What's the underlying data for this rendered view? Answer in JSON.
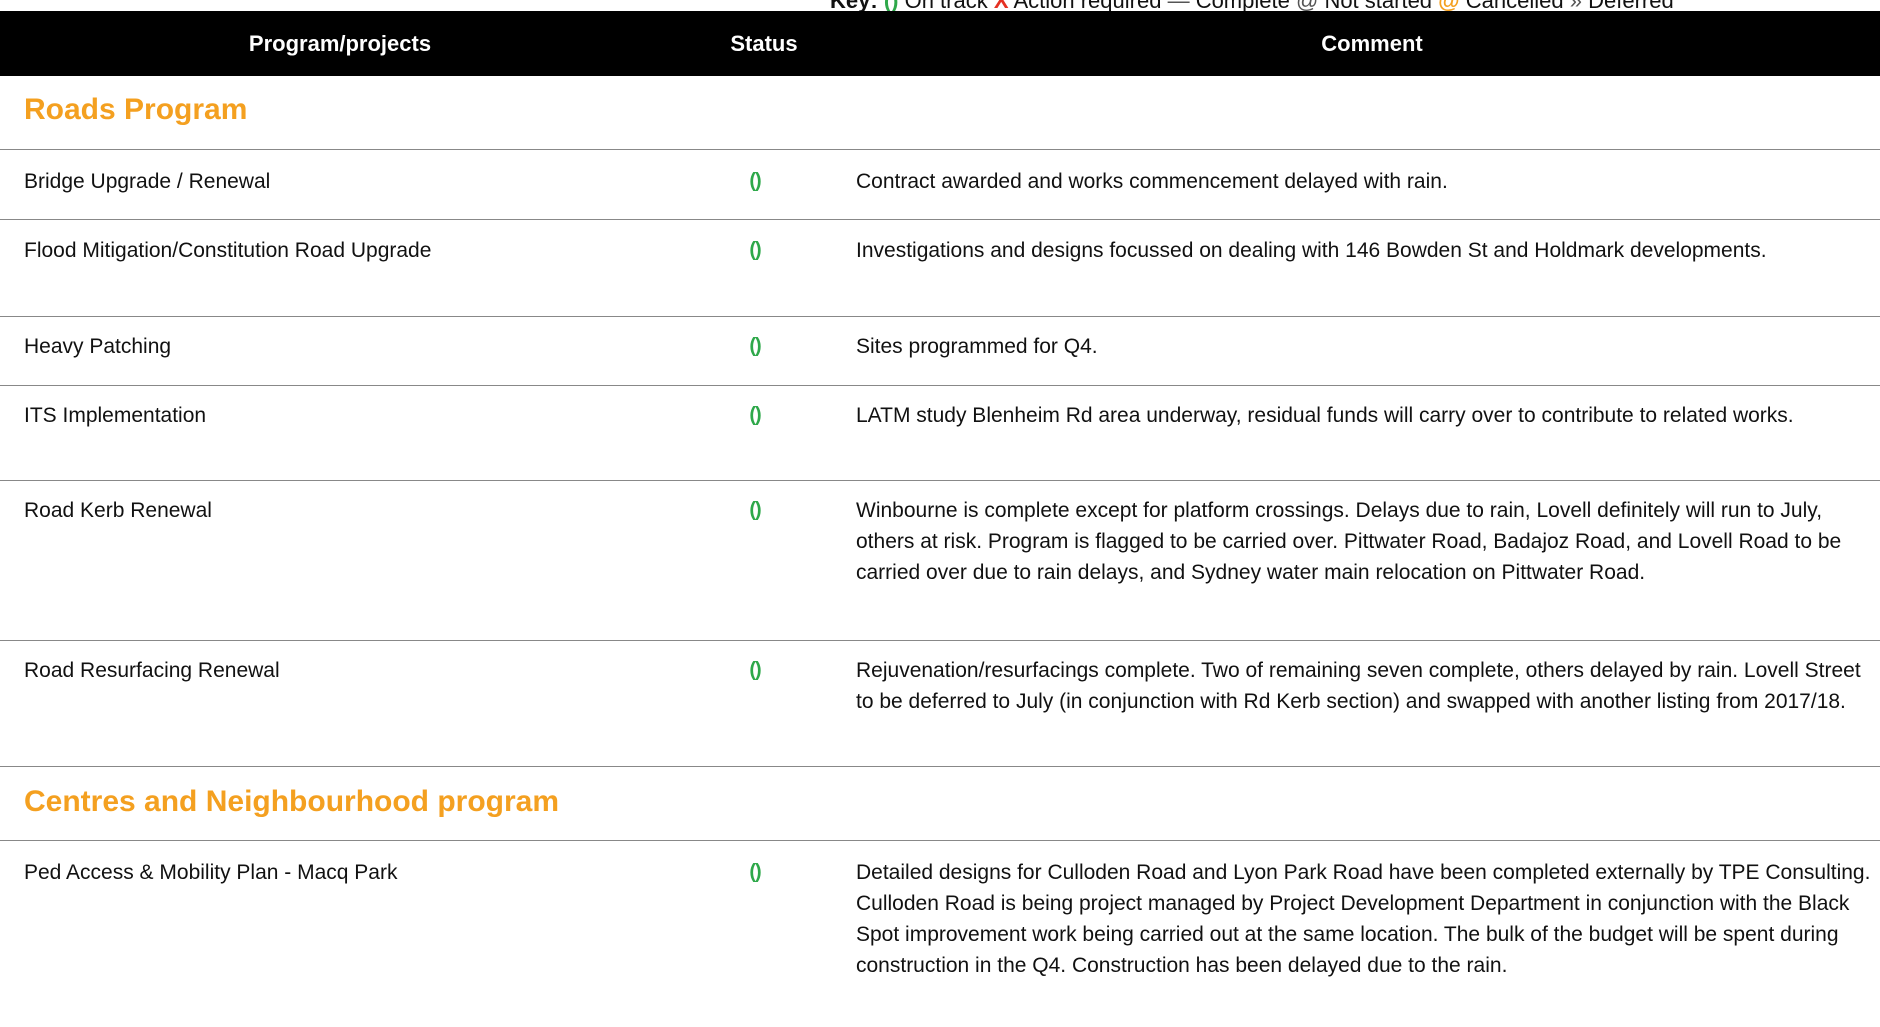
{
  "key": {
    "label": "Key:",
    "on_track_symbol": "()",
    "on_track": "On track",
    "action_symbol": "X",
    "action": "Action required",
    "complete_symbol": "—",
    "complete": "Complete",
    "not_started_symbol": "@",
    "not_started": "Not started",
    "cancelled_symbol": "@",
    "cancelled": "Cancelled",
    "deferred_symbol": "»",
    "deferred": "Deferred"
  },
  "header": {
    "program": "Program/projects",
    "status": "Status",
    "comment": "Comment"
  },
  "sections": [
    {
      "title": "Roads Program",
      "rows": [
        {
          "name": "Bridge Upgrade / Renewal",
          "status": "()",
          "comment": "Contract awarded and works commencement delayed with rain."
        },
        {
          "name": "Flood Mitigation/Constitution Road Upgrade",
          "status": "()",
          "comment": "Investigations and designs focussed on dealing with 146 Bowden St and Holdmark developments."
        },
        {
          "name": "Heavy Patching",
          "status": "()",
          "comment": "Sites programmed for Q4."
        },
        {
          "name": "ITS Implementation",
          "status": "()",
          "comment": "LATM study Blenheim Rd area underway, residual funds will carry over to contribute to related works."
        },
        {
          "name": "Road Kerb Renewal",
          "status": "()",
          "comment": "Winbourne is complete except for platform crossings. Delays due to rain, Lovell definitely will run to July, others at risk. Program is flagged to be carried over. Pittwater Road, Badajoz Road, and Lovell Road to be carried over due to rain delays, and Sydney water main relocation on Pittwater Road."
        },
        {
          "name": "Road Resurfacing Renewal",
          "status": "()",
          "comment": "Rejuvenation/resurfacings complete. Two of remaining seven complete, others delayed by rain. Lovell Street to be deferred to July (in conjunction with Rd Kerb section) and swapped with another listing from 2017/18."
        }
      ]
    },
    {
      "title": "Centres and Neighbourhood program",
      "rows": [
        {
          "name": "Ped Access & Mobility Plan - Macq Park",
          "status": "()",
          "comment": "Detailed designs for Culloden Road and Lyon Park Road have been completed externally by TPE Consulting. Culloden Road is being project managed by Project Development Department in conjunction with the Black Spot improvement work being carried out at the same location. The bulk of the budget will be spent during construction in the Q4. Construction has been delayed due to the rain."
        }
      ]
    }
  ]
}
